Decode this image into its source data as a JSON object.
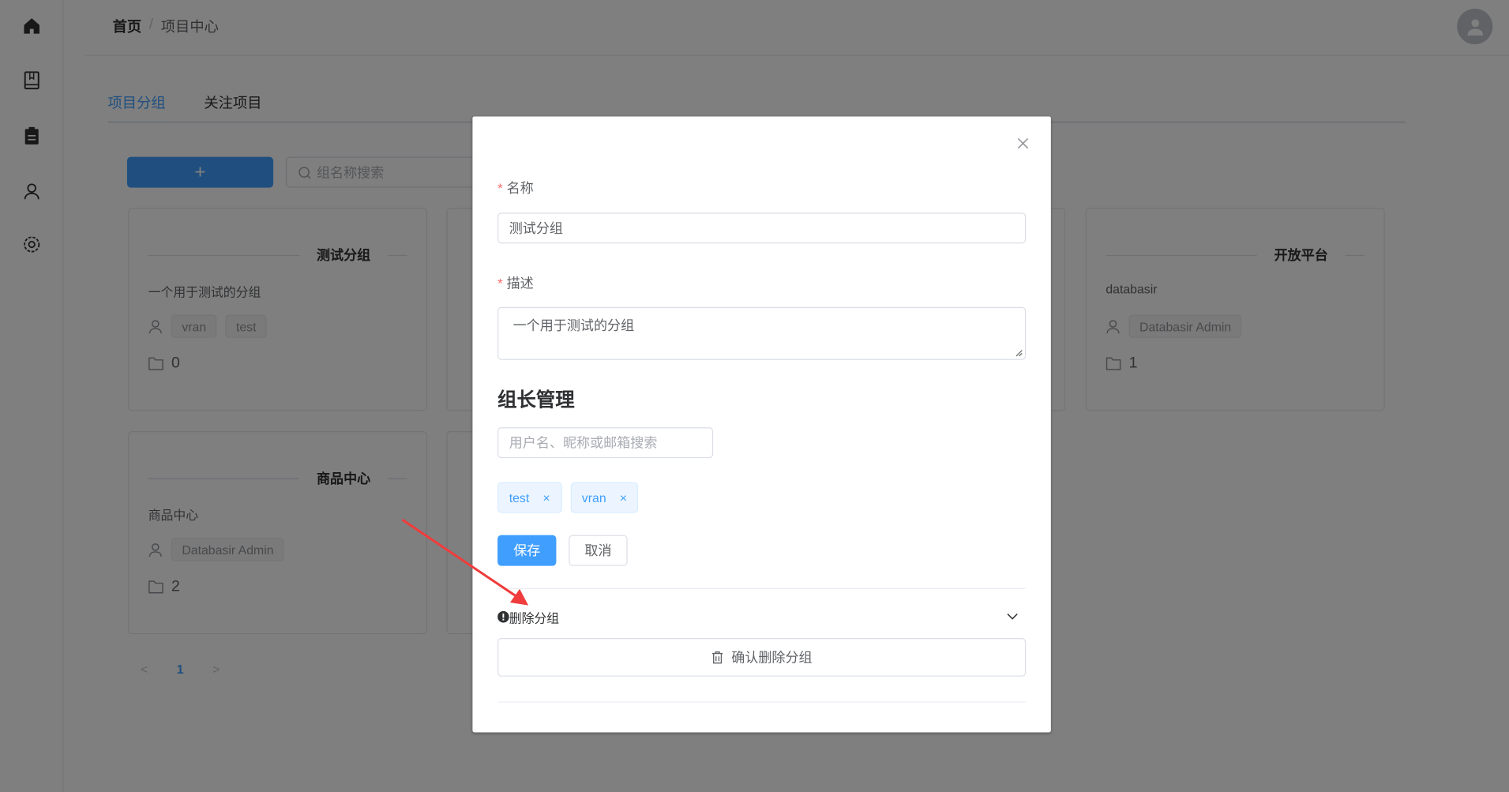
{
  "sidebar": {
    "items": [
      {
        "icon": "home-icon"
      },
      {
        "icon": "book-icon"
      },
      {
        "icon": "clipboard-icon"
      },
      {
        "icon": "user-icon"
      },
      {
        "icon": "gear-icon"
      }
    ]
  },
  "breadcrumb": {
    "home": "首页",
    "separator": "/",
    "current": "项目中心"
  },
  "tabs": [
    {
      "label": "项目分组",
      "active": true
    },
    {
      "label": "关注项目",
      "active": false
    }
  ],
  "toolbar": {
    "add_label": "+",
    "search_placeholder": "组名称搜索"
  },
  "cards": [
    {
      "title": "测试分组",
      "description": "一个用于测试的分组",
      "owners": [
        "vran",
        "test"
      ],
      "project_count": "0"
    },
    {
      "title": "开放平台",
      "description": "databasir",
      "owners": [
        "Databasir Admin"
      ],
      "project_count": "1"
    },
    {
      "title": "商品中心",
      "description": "商品中心",
      "owners": [
        "Databasir Admin"
      ],
      "project_count": "2"
    }
  ],
  "pagination": {
    "prev": "<",
    "current": "1",
    "next": ">"
  },
  "modal": {
    "name_label": "名称",
    "name_value": "测试分组",
    "desc_label": "描述",
    "desc_value": "一个用于测试的分组",
    "required_mark": "*",
    "owner_section_title": "组长管理",
    "owner_search_placeholder": "用户名、昵称或邮箱搜索",
    "owner_tags": [
      "test",
      "vran"
    ],
    "save_label": "保存",
    "cancel_label": "取消",
    "danger_title": "删除分组",
    "confirm_delete_label": "确认删除分组"
  },
  "colors": {
    "primary": "#409eff",
    "danger_mark": "#f56c6c",
    "annotation_arrow": "#f03c3c"
  }
}
